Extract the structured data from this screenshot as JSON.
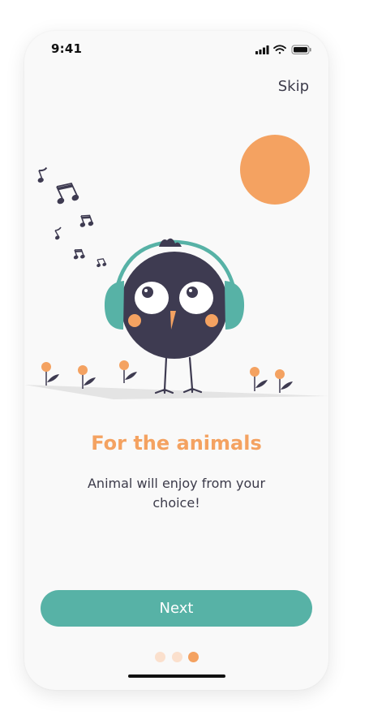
{
  "status_bar": {
    "time": "9:41",
    "icons": [
      "cellular-signal-icon",
      "wifi-icon",
      "battery-icon"
    ]
  },
  "header": {
    "skip_label": "Skip"
  },
  "illustration": {
    "subject": "bird-with-headphones",
    "elements": [
      "sun",
      "music-notes",
      "flowers",
      "ground"
    ]
  },
  "content": {
    "title": "For the animals",
    "subtitle": "Animal will enjoy from your choice!"
  },
  "actions": {
    "next_label": "Next"
  },
  "pagination": {
    "total": 3,
    "current": 3
  },
  "colors": {
    "accent_orange": "#f4a261",
    "accent_teal": "#57b2a6",
    "dot_inactive": "#fbe0cd",
    "bird_body": "#3e3b51",
    "text_dark": "#3c3b4a",
    "background": "#f9f9f9"
  }
}
